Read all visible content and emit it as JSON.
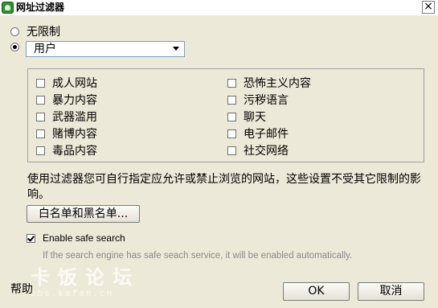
{
  "window": {
    "title": "网址过滤器",
    "close_label": "×"
  },
  "mode": {
    "unrestricted_label": "无限制",
    "user_selected": "用户"
  },
  "categories": {
    "left": [
      "成人网站",
      "暴力内容",
      "武器滥用",
      "赌博内容",
      "毒品内容"
    ],
    "right": [
      "恐怖主义内容",
      "污秽语言",
      "聊天",
      "电子邮件",
      "社交网络"
    ]
  },
  "description": "使用过滤器您可自行指定应允许或禁止浏览的网站，这些设置不受其它限制的影响。",
  "whitelist_button": "白名单和黑名单...",
  "safe_search": {
    "label": "Enable safe search",
    "checked": true,
    "hint": "If the search engine has safe seach service, it will be enabled automatically."
  },
  "footer": {
    "help": "帮助",
    "ok": "OK",
    "cancel": "取消",
    "watermark": "卡饭论坛",
    "watermark_url": "bbs.kafan.cn"
  },
  "colors": {
    "dialog_bg": "#ece9d8",
    "title_icon": "#2f8f2f"
  }
}
